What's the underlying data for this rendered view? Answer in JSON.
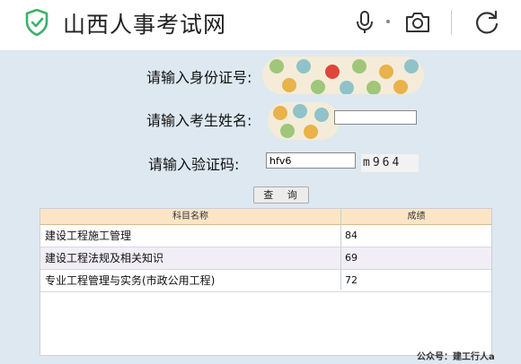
{
  "browser": {
    "site_title": "山西人事考试网",
    "icons": [
      "shield-check-icon",
      "microphone-icon",
      "camera-icon",
      "refresh-icon"
    ]
  },
  "form": {
    "id_label": "请输入身份证号:",
    "name_label": "请输入考生姓名:",
    "captcha_label": "请输入验证码:",
    "captcha_value": "hfv6",
    "captcha_image_text": "m964",
    "query_button": "查 询"
  },
  "results": {
    "headers": [
      "科目名称",
      "成绩"
    ],
    "rows": [
      {
        "subject": "建设工程施工管理",
        "score": "84"
      },
      {
        "subject": "建设工程法规及相关知识",
        "score": "69"
      },
      {
        "subject": "专业工程管理与实务(市政公用工程)",
        "score": "72"
      }
    ]
  },
  "watermark": "公众号：建工行人a",
  "colors": {
    "page_bg": "#dde8f1",
    "shield_green": "#3bb26b",
    "table_header_bg": "#fbe5c6",
    "row_alt_bg": "#f1eef7"
  }
}
